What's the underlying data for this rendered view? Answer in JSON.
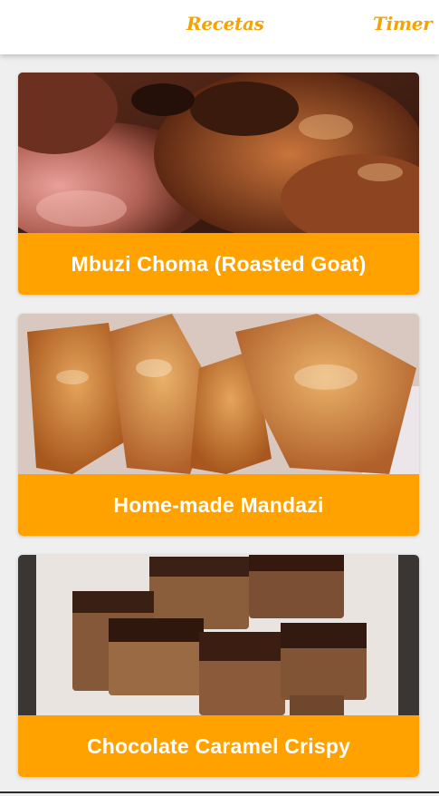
{
  "nav": {
    "recetas_label": "Recetas",
    "timer_label": "Timer",
    "accent_color": "#f5a300"
  },
  "recipes": [
    {
      "title": "Mbuzi Choma (Roasted Goat)",
      "image": "roasted-goat-photo"
    },
    {
      "title": "Home-made Mandazi",
      "image": "mandazi-photo"
    },
    {
      "title": "Chocolate Caramel Crispy",
      "image": "chocolate-crispy-photo"
    }
  ],
  "colors": {
    "title_bar": "#ffa200",
    "title_text": "#ffffff",
    "background": "#efefef"
  }
}
